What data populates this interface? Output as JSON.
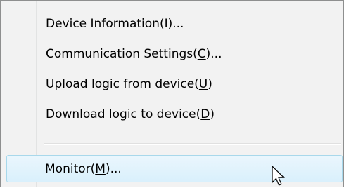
{
  "menu": {
    "items": [
      {
        "text": "Device Information(",
        "mnemonic": "I",
        "suffix": ")..."
      },
      {
        "text": "Communication Settings(",
        "mnemonic": "C",
        "suffix": ")..."
      },
      {
        "text": "Upload logic from device(",
        "mnemonic": "U",
        "suffix": ")"
      },
      {
        "text": "Download logic to device(",
        "mnemonic": "D",
        "suffix": ")"
      },
      {
        "text": "Monitor(",
        "mnemonic": "M",
        "suffix": ")..."
      }
    ],
    "highlighted_index": 4
  },
  "colors": {
    "menu_background": "#f2f2f2",
    "menu_border": "#8e8f8f",
    "highlight_border": "#a8d8eb",
    "highlight_fill": "#e3f3fc"
  },
  "cursor": {
    "icon": "arrow-pointer-icon"
  }
}
